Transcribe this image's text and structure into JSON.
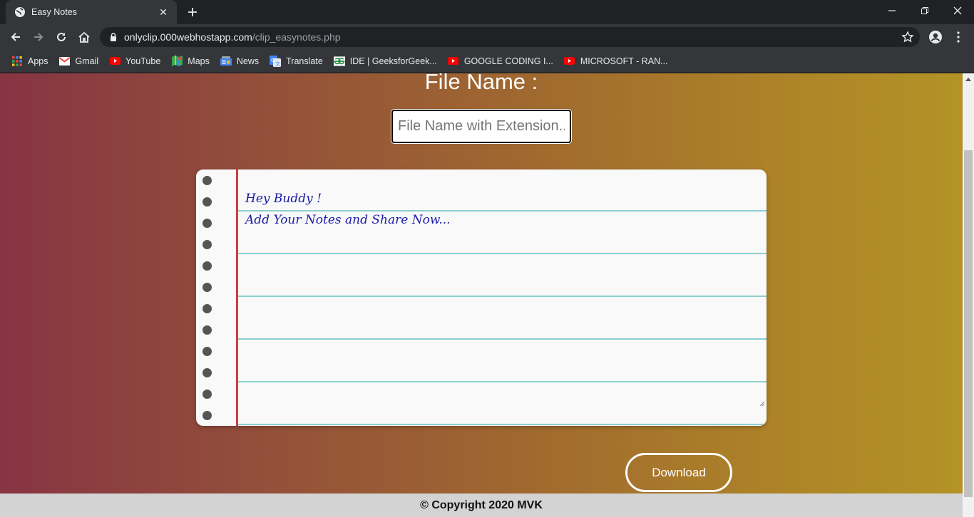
{
  "browser": {
    "tab": {
      "title": "Easy Notes",
      "icon": "globe-icon"
    },
    "url": {
      "host": "onlyclip.000webhostapp.com",
      "path": "/clip_easynotes.php"
    },
    "bookmarks": [
      {
        "label": "Apps",
        "icon": "apps-grid-icon"
      },
      {
        "label": "Gmail",
        "icon": "gmail-icon"
      },
      {
        "label": "YouTube",
        "icon": "youtube-icon"
      },
      {
        "label": "Maps",
        "icon": "maps-icon"
      },
      {
        "label": "News",
        "icon": "news-icon"
      },
      {
        "label": "Translate",
        "icon": "translate-icon"
      },
      {
        "label": "IDE | GeeksforGeek...",
        "icon": "geeksforgeeks-icon"
      },
      {
        "label": "GOOGLE CODING I...",
        "icon": "youtube-icon"
      },
      {
        "label": "MICROSOFT - RAN...",
        "icon": "youtube-icon"
      }
    ]
  },
  "page": {
    "file_label": "File Name :",
    "file_placeholder": "File Name with Extension..",
    "notes": {
      "line1": "Hey Buddy !",
      "line2": "Add Your Notes and Share Now..."
    },
    "download_label": "Download",
    "footer": "© Copyright 2020 MVK"
  },
  "colors": {
    "gradient_left": "#873443",
    "gradient_right": "#b39326",
    "margin_line": "#cd3c40",
    "ruled_line": "#8dcfcf",
    "note_text": "#1a1aa6"
  }
}
